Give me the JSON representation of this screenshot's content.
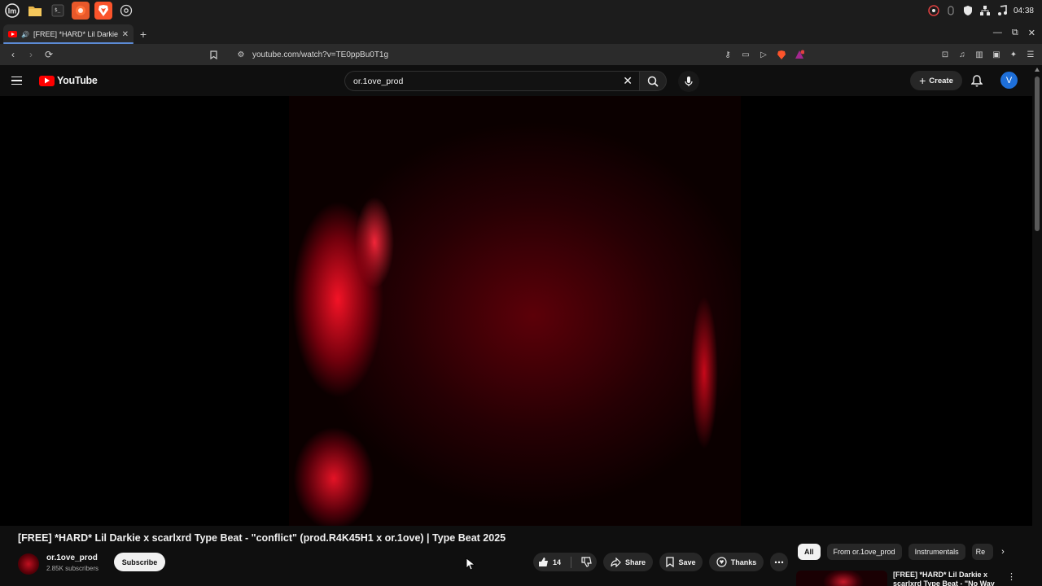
{
  "os_bar": {
    "apps": [
      "menu-icon",
      "files-icon",
      "terminal-icon",
      "firefox-icon",
      "brave-icon",
      "settings-icon"
    ],
    "clock": "04:38"
  },
  "browser": {
    "tab_title": "[FREE] *HARD* Lil Darkie x",
    "new_tab": "+",
    "url": "youtube.com/watch?v=TE0ppBu0T1g"
  },
  "youtube": {
    "logo_text": "YouTube",
    "search_value": "or.1ove_prod",
    "create_label": "Create",
    "avatar_letter": "V"
  },
  "video": {
    "title": "[FREE] *HARD* Lil Darkie x scarlxrd Type Beat - \"conflict\" (prod.R4K45H1 x or.1ove) | Type Beat 2025",
    "channel_name": "or.1ove_prod",
    "subscribers": "2.85K subscribers",
    "subscribe_label": "Subscribe",
    "like_count": "14",
    "share_label": "Share",
    "save_label": "Save",
    "thanks_label": "Thanks"
  },
  "recommendations": {
    "chips": [
      "All",
      "From or.1ove_prod",
      "Instrumentals",
      "Re"
    ],
    "first_title": "[FREE] *HARD* Lil Darkie x scarlxrd Type Beat - \"No Way"
  },
  "colors": {
    "youtube_red": "#ff0000",
    "avatar_blue": "#1e6fd9",
    "background": "#0f0f0f"
  }
}
